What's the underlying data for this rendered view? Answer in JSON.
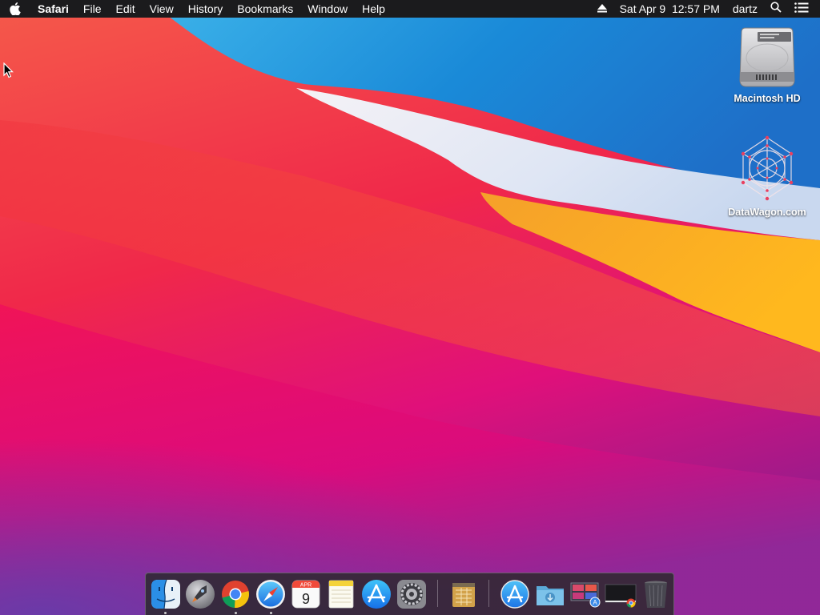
{
  "menubar": {
    "apple_icon": "apple-icon",
    "app_name": "Safari",
    "menus": [
      "File",
      "Edit",
      "View",
      "History",
      "Bookmarks",
      "Window",
      "Help"
    ],
    "clock": "Sat Apr 9  12:57 PM",
    "user": "dartz",
    "right_icons": [
      "eject-icon",
      "spotlight-search-icon",
      "control-center-list-icon"
    ]
  },
  "desktop": {
    "icons": [
      {
        "name": "hard-drive-icon",
        "label": "Macintosh HD"
      },
      {
        "name": "datawagon-logo-icon",
        "label": "DataWagon.com"
      }
    ]
  },
  "dock": {
    "calendar_month": "APR",
    "calendar_day": "9",
    "apps": [
      "finder-icon",
      "launchpad-icon",
      "chrome-icon",
      "safari-icon",
      "calendar-icon",
      "notes-icon",
      "app-store-icon",
      "system-preferences-icon"
    ],
    "stacks": [
      "archive-utility-icon",
      "applications-folder-icon",
      "downloads-folder-icon",
      "screenshots-stack-icon",
      "chrome-window-stack-icon",
      "trash-icon"
    ],
    "running_indicators": [
      "finder",
      "chrome",
      "safari"
    ]
  }
}
